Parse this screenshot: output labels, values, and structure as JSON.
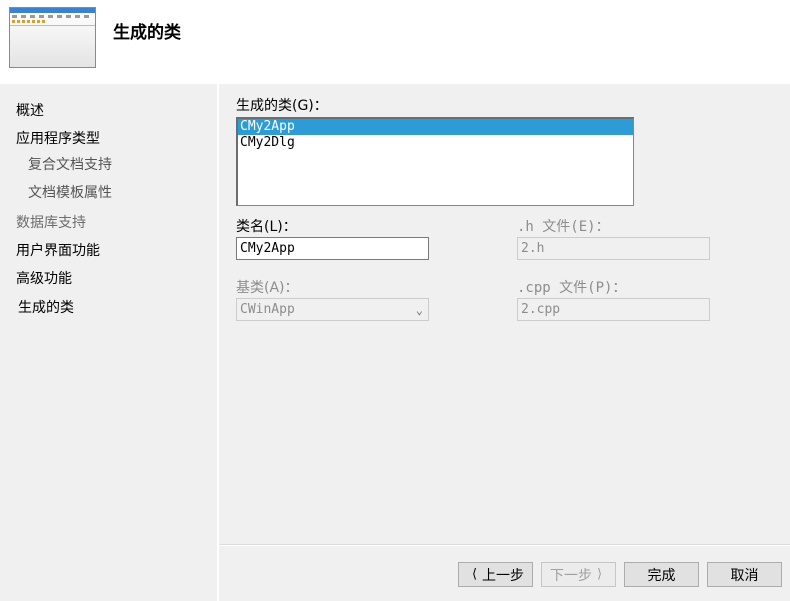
{
  "header": {
    "title": "生成的类"
  },
  "nav": {
    "items": [
      {
        "label": "概述"
      },
      {
        "label": "应用程序类型"
      },
      {
        "label": "复合文档支持"
      },
      {
        "label": "文档模板属性"
      },
      {
        "label": "数据库支持"
      },
      {
        "label": "用户界面功能"
      },
      {
        "label": "高级功能"
      },
      {
        "label": "生成的类"
      }
    ]
  },
  "main": {
    "generated_classes_label": "生成的类(G)：",
    "generated_classes": [
      "CMy2App",
      "CMy2Dlg"
    ],
    "class_name_label": "类名(L)：",
    "class_name_value": "CMy2App",
    "h_file_label": ".h 文件(E)：",
    "h_file_value": "2.h",
    "base_class_label": "基类(A)：",
    "base_class_value": "CWinApp",
    "cpp_file_label": ".cpp 文件(P)：",
    "cpp_file_value": "2.cpp"
  },
  "footer": {
    "prev": "上一步",
    "next": "下一步",
    "finish": "完成",
    "cancel": "取消"
  }
}
